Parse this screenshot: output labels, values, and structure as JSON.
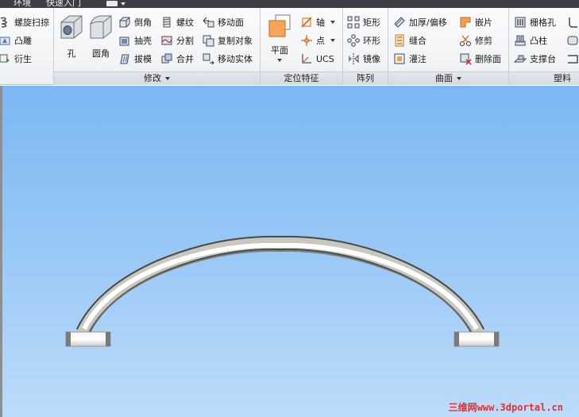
{
  "menubar": {
    "tab_env": "环境",
    "tab_quick": "快速入门"
  },
  "panels": {
    "create_partial": {
      "items": [
        "螺旋扫掠",
        "凸雕",
        "衍生"
      ]
    },
    "modify": {
      "title": "修改",
      "large": [
        "孔",
        "圆角"
      ],
      "col1": [
        "倒角",
        "抽壳",
        "拔模"
      ],
      "col2": [
        "螺纹",
        "分割",
        "合并"
      ],
      "col3": [
        "移动面",
        "复制对象",
        "移动实体"
      ]
    },
    "work_features": {
      "title": "定位特征",
      "large": "平面",
      "items": [
        "轴",
        "点",
        "UCS"
      ]
    },
    "pattern": {
      "title": "阵列",
      "items": [
        "矩形",
        "环形",
        "镜像"
      ]
    },
    "surface": {
      "title": "曲面",
      "col1": [
        "加厚/偏移",
        "缝合",
        "灌注"
      ],
      "col2": [
        "嵌片",
        "修剪",
        "删除面"
      ]
    },
    "plastic": {
      "title": "塑料零",
      "items": [
        "栅格孔",
        "凸柱",
        "支撑台"
      ]
    }
  },
  "watermark": "三维网www.3dportal.cn",
  "colors": {
    "viewport_top": "#7cb7f4",
    "viewport_bottom": "#bcdcfa",
    "ribbon_bg": "#f3f4f6",
    "watermark": "#e03030"
  }
}
